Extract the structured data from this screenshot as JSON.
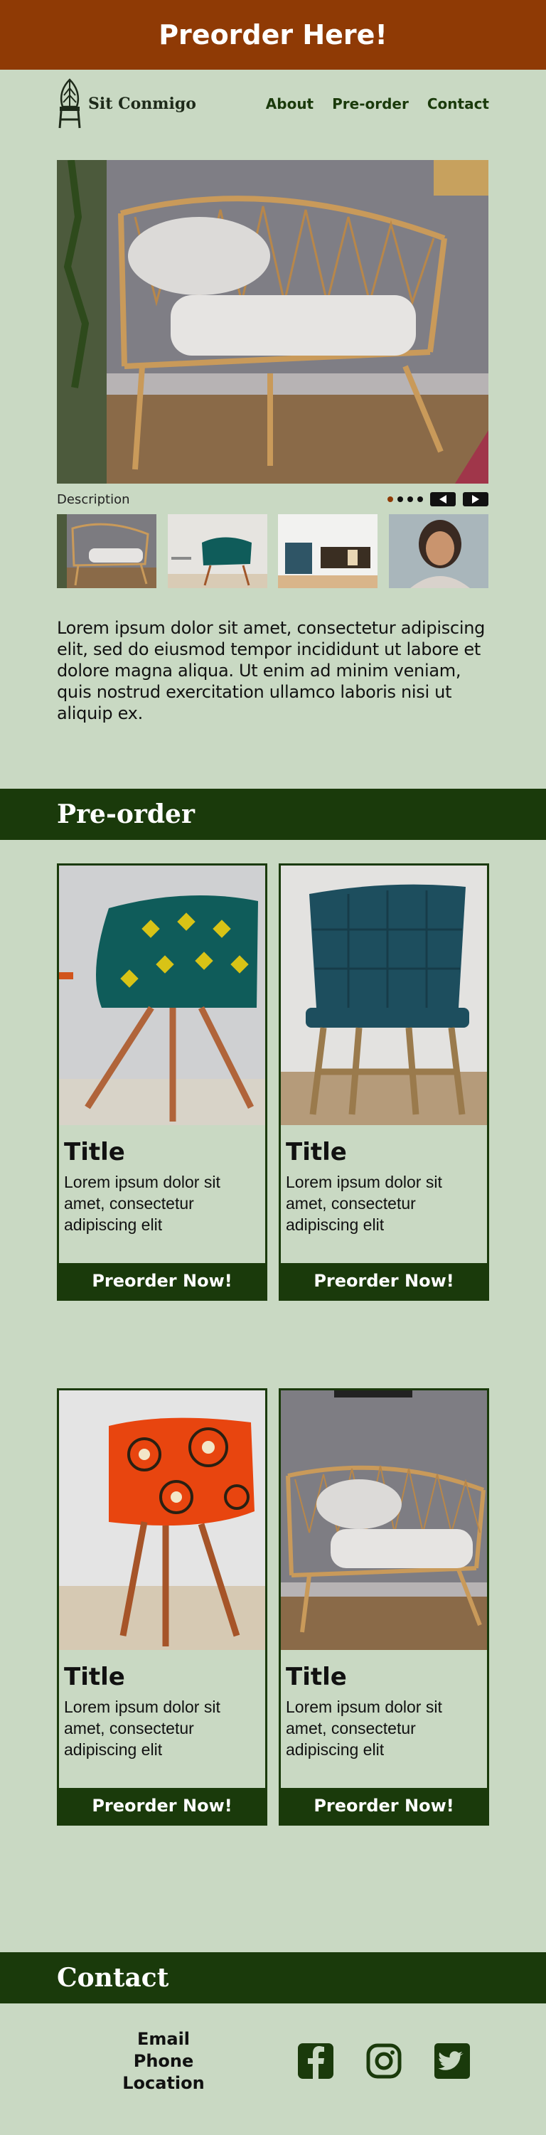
{
  "banner": {
    "text": "Preorder Here!"
  },
  "brand": {
    "name": "Sit Conmigo"
  },
  "nav": {
    "links": [
      "About",
      "Pre-order",
      "Contact"
    ]
  },
  "gallery": {
    "description_label": "Description",
    "dots": 4,
    "active_dot": 0
  },
  "intro": {
    "text": "Lorem ipsum dolor sit amet, consectetur adipiscing elit, sed do eiusmod tempor incididunt ut labore et dolore magna aliqua. Ut enim ad minim veniam, quis nostrud exercitation ullamco laboris nisi ut aliquip ex."
  },
  "preorder": {
    "heading": "Pre-order",
    "cards": [
      {
        "title": "Title",
        "text": "Lorem ipsum dolor sit amet, consectetur adipiscing elit",
        "button": "Preorder Now!"
      },
      {
        "title": "Title",
        "text": "Lorem ipsum dolor sit amet, consectetur adipiscing elit",
        "button": "Preorder Now!"
      },
      {
        "title": "Title",
        "text": "Lorem ipsum dolor sit amet, consectetur adipiscing elit",
        "button": "Preorder Now!"
      },
      {
        "title": "Title",
        "text": "Lorem ipsum dolor sit amet, consectetur adipiscing elit",
        "button": "Preorder Now!"
      }
    ]
  },
  "contact": {
    "heading": "Contact",
    "email": "Email",
    "phone": "Phone",
    "location": "Location",
    "social_icons": [
      "facebook-icon",
      "instagram-icon",
      "twitter-icon"
    ]
  },
  "colors": {
    "banner": "#8f3a05",
    "primary": "#1a3a0b",
    "background": "#c9d9c3"
  }
}
